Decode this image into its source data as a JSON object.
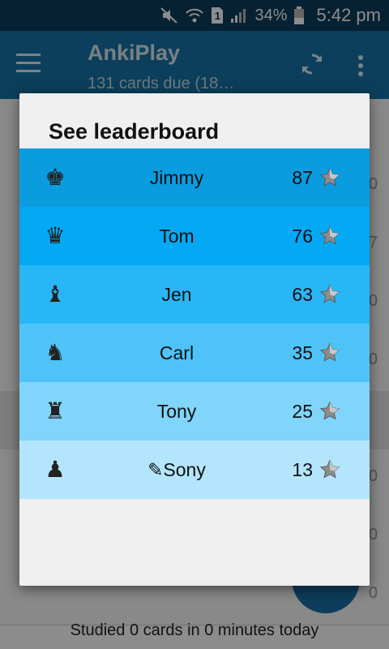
{
  "status_bar": {
    "battery": "34%",
    "time": "5:42 pm",
    "sim_slot": "1",
    "icons": [
      "mute-icon",
      "wifi-icon",
      "sim-icon",
      "signal-icon",
      "battery-icon"
    ]
  },
  "app_bar": {
    "title": "AnkiPlay",
    "subtitle": "131 cards due (18…"
  },
  "background_list": {
    "numbers": [
      "0",
      "7",
      "0",
      "0",
      "0",
      "0",
      "0"
    ]
  },
  "footer": {
    "text": "Studied 0 cards in 0 minutes today"
  },
  "dialog": {
    "title": "See leaderboard",
    "rows": [
      {
        "piece": "king-icon",
        "name": "Jimmy",
        "score": "87",
        "bg": "#0a9cdf"
      },
      {
        "piece": "queen-icon",
        "name": "Tom",
        "score": "76",
        "bg": "#04a9f4"
      },
      {
        "piece": "bishop-icon",
        "name": "Jen",
        "score": "63",
        "bg": "#29b6f6"
      },
      {
        "piece": "knight-icon",
        "name": "Carl",
        "score": "35",
        "bg": "#4fc3f7"
      },
      {
        "piece": "rook-icon",
        "name": "Tony",
        "score": "25",
        "bg": "#81d4fa"
      },
      {
        "piece": "pawn-icon",
        "name": "✎Sony",
        "score": "13",
        "bg": "#b3e5fc"
      }
    ]
  },
  "colors": {
    "status_bar": "#0b3d5c",
    "app_bar": "#1573a8",
    "dialog_bg": "#efefef",
    "accent_fab": "#1b6fa7"
  }
}
